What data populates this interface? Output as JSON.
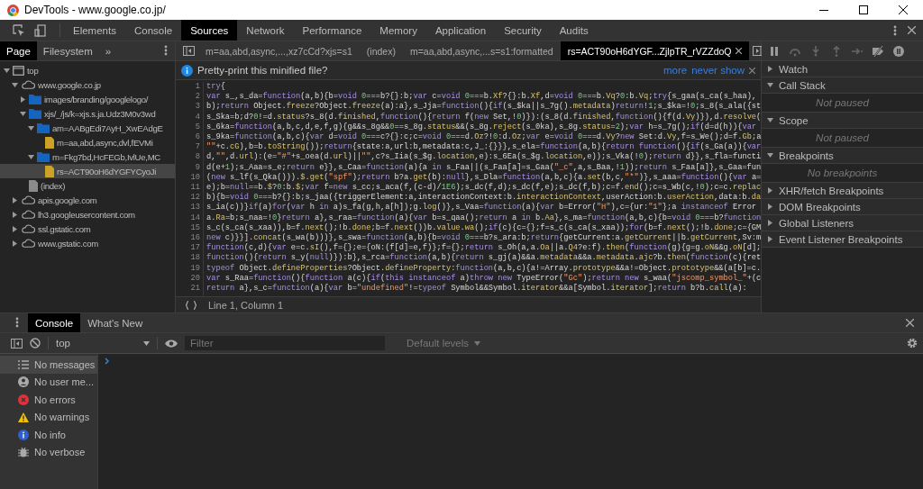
{
  "window": {
    "title": "DevTools - www.google.co.jp/"
  },
  "main_tabs": [
    {
      "label": "Elements",
      "selected": false
    },
    {
      "label": "Console",
      "selected": false
    },
    {
      "label": "Sources",
      "selected": true
    },
    {
      "label": "Network",
      "selected": false
    },
    {
      "label": "Performance",
      "selected": false
    },
    {
      "label": "Memory",
      "selected": false
    },
    {
      "label": "Application",
      "selected": false
    },
    {
      "label": "Security",
      "selected": false
    },
    {
      "label": "Audits",
      "selected": false
    }
  ],
  "navigator": {
    "tabs": [
      {
        "label": "Page",
        "selected": true
      },
      {
        "label": "Filesystem",
        "selected": false
      }
    ],
    "more": "»",
    "tree": [
      {
        "label": "top",
        "kind": "frame",
        "expanded": true,
        "selected": false,
        "children": [
          {
            "label": "www.google.co.jp",
            "kind": "domain",
            "expanded": true,
            "selected": false,
            "children": [
              {
                "label": "images/branding/googlelogo/",
                "kind": "folder",
                "expanded": false,
                "selected": false
              },
              {
                "label": "xjs/_/js/k=xjs.s.ja.Udz3M0v3wd",
                "kind": "folder",
                "expanded": true,
                "selected": false,
                "children": [
                  {
                    "label": "am=AABgEdi7AyH_XwEAdgE",
                    "kind": "folder",
                    "expanded": true,
                    "selected": false,
                    "children": [
                      {
                        "label": "m=aa,abd,async,dvl,fEVMi",
                        "kind": "script",
                        "selected": false
                      }
                    ]
                  },
                  {
                    "label": "m=Fkg7bd,HcFEGb,IvlUe,MC",
                    "kind": "folder",
                    "expanded": true,
                    "selected": false,
                    "children": [
                      {
                        "label": "rs=ACT90oH6dYGFYCyoJi",
                        "kind": "script",
                        "selected": true
                      }
                    ]
                  }
                ]
              },
              {
                "label": "(index)",
                "kind": "document",
                "selected": false
              }
            ]
          },
          {
            "label": "apis.google.com",
            "kind": "domain",
            "expanded": false,
            "selected": false
          },
          {
            "label": "lh3.googleusercontent.com",
            "kind": "domain",
            "expanded": false,
            "selected": false
          },
          {
            "label": "ssl.gstatic.com",
            "kind": "domain",
            "expanded": false,
            "selected": false
          },
          {
            "label": "www.gstatic.com",
            "kind": "domain",
            "expanded": false,
            "selected": false
          }
        ]
      }
    ]
  },
  "editor": {
    "tabs": [
      {
        "label": "m=aa,abd,async,...,xz7cCd?xjs=s1",
        "selected": false
      },
      {
        "label": "(index)",
        "selected": false
      },
      {
        "label": "m=aa,abd,async,...s=s1:formatted",
        "selected": false
      },
      {
        "label": "rs=ACT90oH6dYGF...ZjlpTR_rVZZdoQ",
        "selected": true
      }
    ],
    "infobar": {
      "message": "Pretty-print this minified file?",
      "links": [
        "more",
        "never show"
      ]
    },
    "lines": [
      {
        "number": "1",
        "text": "try{"
      },
      {
        "number": "2",
        "text": "var s_,s_da=function(a,b){b=void 0===b?{}:b;var c=void 0===b.Xf?{}:b.Xf,d=void 0===b.Vq?0:b.Vq;try{s_gaa(s_ca(s_haa),"
      },
      {
        "number": "3",
        "text": "b);return Object.freeze?Object.freeze(a):a},s_Jja=function(){if(s_$ka||s_7g().metadata)return!1;s_$ka=!0;s_8(s_ala({st"
      },
      {
        "number": "4",
        "text": "s_Ska=b;d?0!=d.status?s_8(d.finished,function(){return f(new Set,!0)}):(s_8(d.finished,function(){f(d.Vy)}),d.resolve("
      },
      {
        "number": "5",
        "text": "s_6ka=function(a,b,c,d,e,f,g){g&&s_8g&&0==s_8g.status&&(s_8g.reject(s_0ka),s_8g.status=2);var h=s_7g();if(d=d(h)){var"
      },
      {
        "number": "6",
        "text": "s_9ka=function(a,b,c){var d=void 0===c?{}:c;c=void 0===d.Oz?!0:d.Oz;var e=void 0===d.Vy?new Set:d.Vy,f=s_We();d=f.Gb;a"
      },
      {
        "number": "7",
        "text": "\"\"+c.cG),b=b.toString());return{state:a,url:b,metadata:c,J_:{}}},s_ela=function(a,b){return function(){if(s_Ga(a)){var"
      },
      {
        "number": "8",
        "text": "d,\"\",d.url):(e=\"#\"+s_oea(d.url)||\"\",c?s_Iia(s_$g.location,e):s_6Ea(s_$g.location,e));s_Vka(!0);return d}},s_fla=functi"
      },
      {
        "number": "9",
        "text": "d(e+1);s_Aaa=s_e;return e}},s_Caa=function(a){a in s_Faa||(s_Faa[a]=s_Gaa(\"_c\",a,s_Baa,!1));return s_Faa[a]},s_Gaa=fun"
      },
      {
        "number": "10",
        "text": "(new s_lf(s_Qka())).$.get(\"spf\");return b?a.get(b):null},s_Dla=function(a,b,c){a.set(b,c,\"*\")},s_aaa=function(){var a="
      },
      {
        "number": "11",
        "text": "e);b=null==b.$?0:b.$;var f=new s_cc;s_aca(f,(c-d)/1E6);s_dc(f,d);s_dc(f,e);s_dc(f,b);c=f.end();c=s_Wb(c,!0);c=c.replac"
      },
      {
        "number": "12",
        "text": "b){b=void 0===b?{}:b;s_jaa({triggerElement:a,interactionContext:b.interactionContext,userAction:b.userAction,data:b.da"
      },
      {
        "number": "13",
        "text": "s_ia(c))}if(a)for(var h in a)s_fa(g,h,a[h]);g.log()},s_Vaa=function(a){var b=Error(\"H\"),c={ur:\"1\"};a instanceof Error"
      },
      {
        "number": "14",
        "text": "a.Ra=b;s_naa=!0}return a},s_raa=function(a){var b=s_qaa();return a in b.Aa},s_ma=function(a,b,c){b=void 0===b?function"
      },
      {
        "number": "15",
        "text": "s_c(s_ca(s_xaa)),b=f.next();!b.done;b=f.next())b.value.wa();if(c){c={};f=s_c(s_ca(s_xaa));for(b=f.next();!b.done;c={GM"
      },
      {
        "number": "16",
        "text": "new c)}}].concat(s_wa(b)))},s_swa=function(a,b){b=void 0===b?s_ara:b;return{getCurrent:a.getCurrent||b.getCurrent,Sv:m"
      },
      {
        "number": "17",
        "text": "function(c,d){var e=c.sI(),f={};e={oN:(f[d]=e,f)};f={};return s_Oh(a,a.Oa||a.Q4?e:f).then(function(g){g=g.oN&&g.oN[d];"
      },
      {
        "number": "18",
        "text": "function(){return s_y(null)}):b},s_rca=function(a,b){return s_gj(a)&&a.metadata&&a.metadata.ajc?b.then(function(c){ret"
      },
      {
        "number": "19",
        "text": "typeof Object.defineProperties?Object.defineProperty:function(a,b,c){a!=Array.prototype&&a!=Object.prototype&&(a[b]=c."
      },
      {
        "number": "20",
        "text": "var s_Raa=function(){function a(c){if(this instanceof a)throw new TypeError(\"Gc\");return new s_waa(\"jscomp_symbol_\"+(c"
      },
      {
        "number": "21",
        "text": "return a},s_c=function(a){var b=\"undefined\"!=typeof Symbol&&Symbol.iterator&&a[Symbol.iterator];return b?b.call(a):"
      }
    ],
    "status": "Line 1, Column 1"
  },
  "debugger": {
    "sections": [
      {
        "title": "Watch",
        "expanded": false
      },
      {
        "title": "Call Stack",
        "expanded": true,
        "message": "Not paused"
      },
      {
        "title": "Scope",
        "expanded": true,
        "message": "Not paused"
      },
      {
        "title": "Breakpoints",
        "expanded": true,
        "message": "No breakpoints"
      },
      {
        "title": "XHR/fetch Breakpoints",
        "expanded": false
      },
      {
        "title": "DOM Breakpoints",
        "expanded": false
      },
      {
        "title": "Global Listeners",
        "expanded": false
      },
      {
        "title": "Event Listener Breakpoints",
        "expanded": false
      }
    ]
  },
  "drawer": {
    "tabs": [
      {
        "label": "Console",
        "selected": true
      },
      {
        "label": "What's New",
        "selected": false
      }
    ],
    "context": "top",
    "filter": {
      "placeholder": "Filter"
    },
    "levels": "Default levels",
    "sidebar": [
      {
        "label": "No messages",
        "kind": "messages",
        "selected": true
      },
      {
        "label": "No user me...",
        "kind": "user",
        "selected": false
      },
      {
        "label": "No errors",
        "kind": "errors",
        "selected": false
      },
      {
        "label": "No warnings",
        "kind": "warnings",
        "selected": false
      },
      {
        "label": "No info",
        "kind": "info",
        "selected": false
      },
      {
        "label": "No verbose",
        "kind": "verbose",
        "selected": false
      }
    ]
  }
}
